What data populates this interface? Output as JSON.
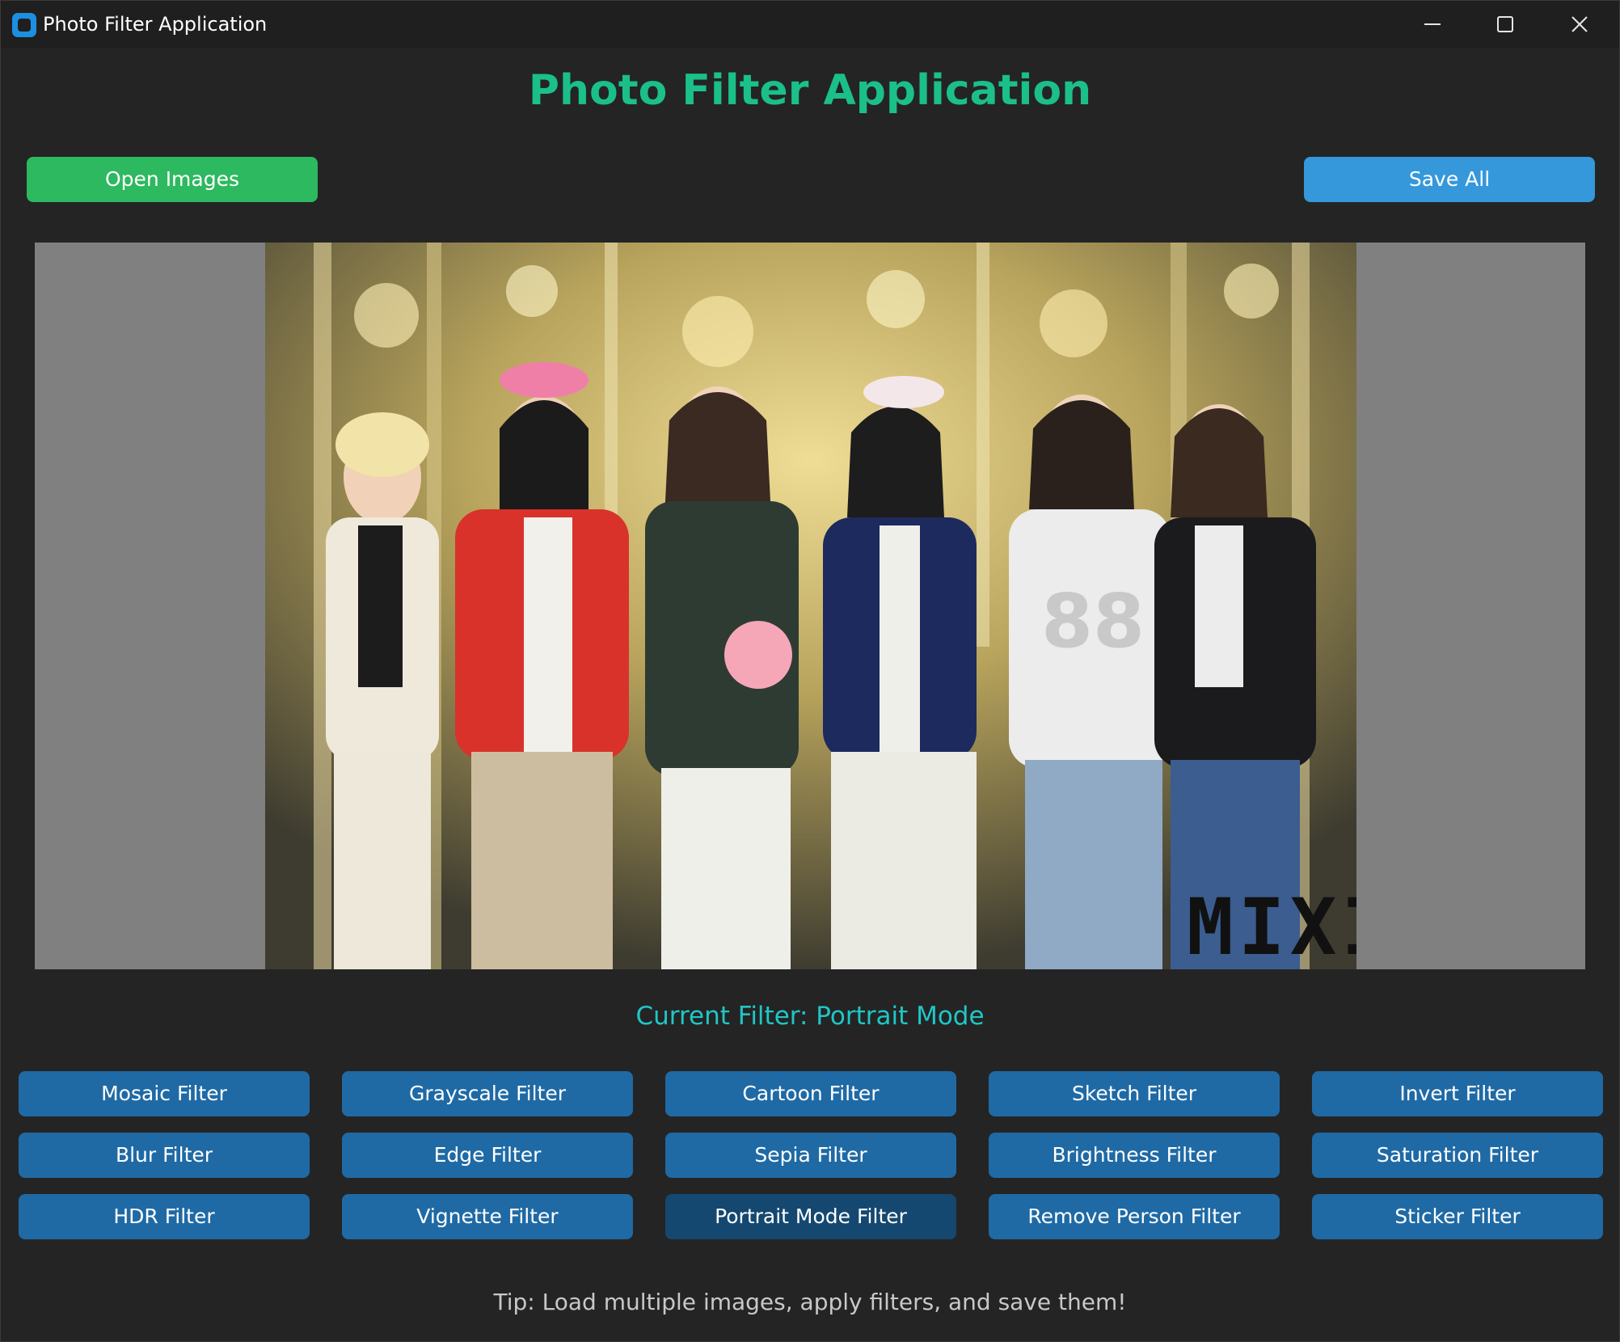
{
  "window": {
    "title": "Photo Filter Application"
  },
  "header": {
    "title": "Photo Filter Application"
  },
  "toolbar": {
    "open_label": "Open Images",
    "save_label": "Save All"
  },
  "preview": {
    "watermark": "MIXI"
  },
  "status": {
    "current_filter": "Current Filter: Portrait Mode"
  },
  "filters": [
    {
      "label": "Mosaic Filter"
    },
    {
      "label": "Grayscale Filter"
    },
    {
      "label": "Cartoon Filter"
    },
    {
      "label": "Sketch Filter"
    },
    {
      "label": "Invert Filter"
    },
    {
      "label": "Blur Filter"
    },
    {
      "label": "Edge Filter"
    },
    {
      "label": "Sepia Filter"
    },
    {
      "label": "Brightness Filter"
    },
    {
      "label": "Saturation Filter"
    },
    {
      "label": "HDR Filter"
    },
    {
      "label": "Vignette Filter"
    },
    {
      "label": "Portrait Mode Filter",
      "active": true
    },
    {
      "label": "Remove Person Filter"
    },
    {
      "label": "Sticker Filter"
    }
  ],
  "footer": {
    "tip": "Tip: Load multiple images, apply filters, and save them!"
  },
  "colors": {
    "background": "#242424",
    "heading": "#1bbf8a",
    "open_button": "#2db95f",
    "save_button": "#3498db",
    "filter_button": "#1f6aa5",
    "filter_button_active": "#144870",
    "current_filter_text": "#1fc7c7",
    "image_panel": "#808080"
  },
  "icons": [
    "app-icon",
    "minimize-icon",
    "maximize-icon",
    "close-icon"
  ]
}
